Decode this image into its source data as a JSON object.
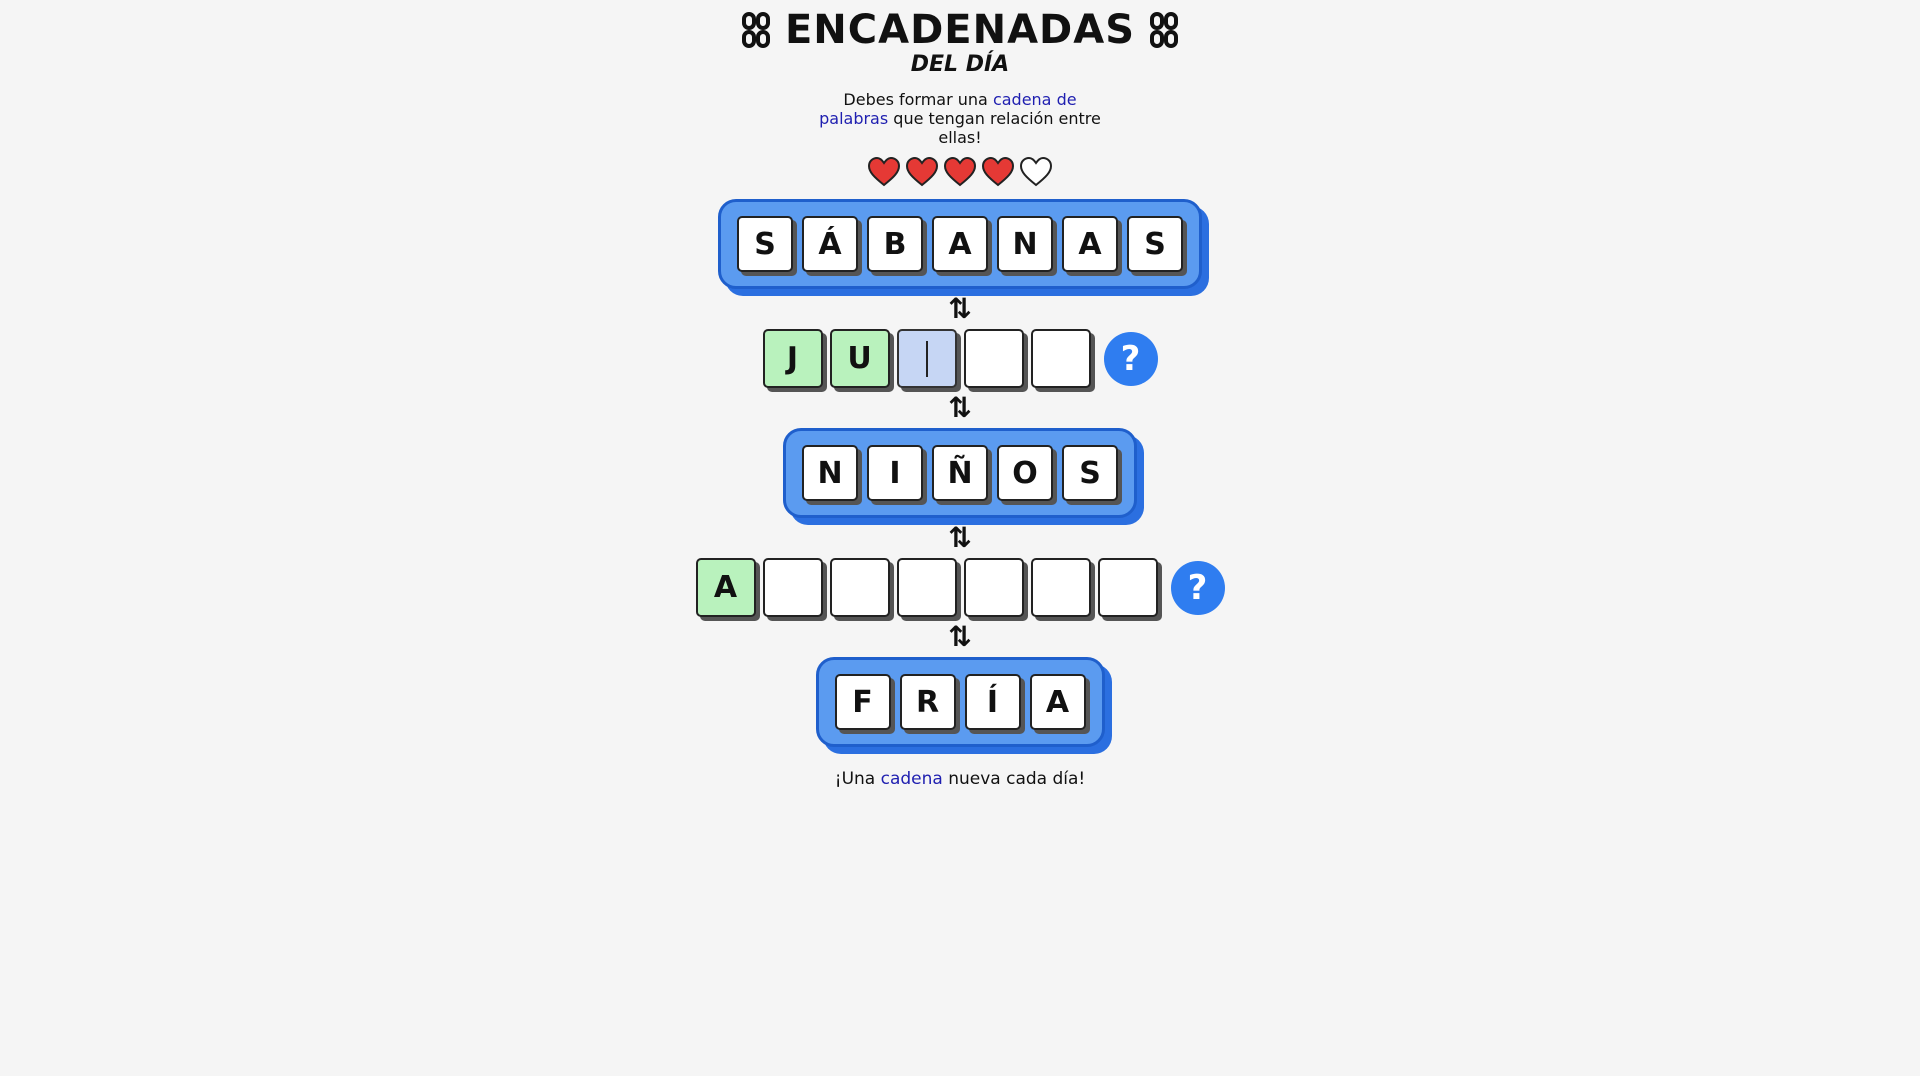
{
  "header": {
    "title": "ENCADENADAS",
    "subtitle": "DEL DÍA",
    "title_icon": "chain-link-icon"
  },
  "intro": {
    "part1": "Debes formar una ",
    "highlight": "cadena de palabras",
    "part2": " que tengan relación entre ellas!"
  },
  "lives": {
    "total": 5,
    "remaining": 4,
    "icon": "heart-icon"
  },
  "chain": [
    {
      "type": "solved",
      "letters": [
        "S",
        "Á",
        "B",
        "A",
        "N",
        "A",
        "S"
      ]
    },
    {
      "type": "guess",
      "letters": [
        "J",
        "U",
        "",
        "",
        ""
      ],
      "revealed": 2,
      "active_index": 2
    },
    {
      "type": "solved",
      "letters": [
        "N",
        "I",
        "Ñ",
        "O",
        "S"
      ]
    },
    {
      "type": "guess",
      "letters": [
        "A",
        "",
        "",
        "",
        "",
        "",
        ""
      ],
      "revealed": 1,
      "active_index": -1
    },
    {
      "type": "solved",
      "letters": [
        "F",
        "R",
        "Í",
        "A"
      ]
    }
  ],
  "link_arrow": "⇅",
  "help_label": "?",
  "footer": {
    "part1": "¡Una ",
    "highlight": "cadena",
    "part2": " nueva cada día!"
  },
  "colors": {
    "accent_blue": "#2f7df0",
    "solved_bg": "#5b9bf0",
    "revealed_green": "#b9f2bd",
    "heart_red": "#e53935",
    "highlight_text": "#1f1fb0"
  }
}
